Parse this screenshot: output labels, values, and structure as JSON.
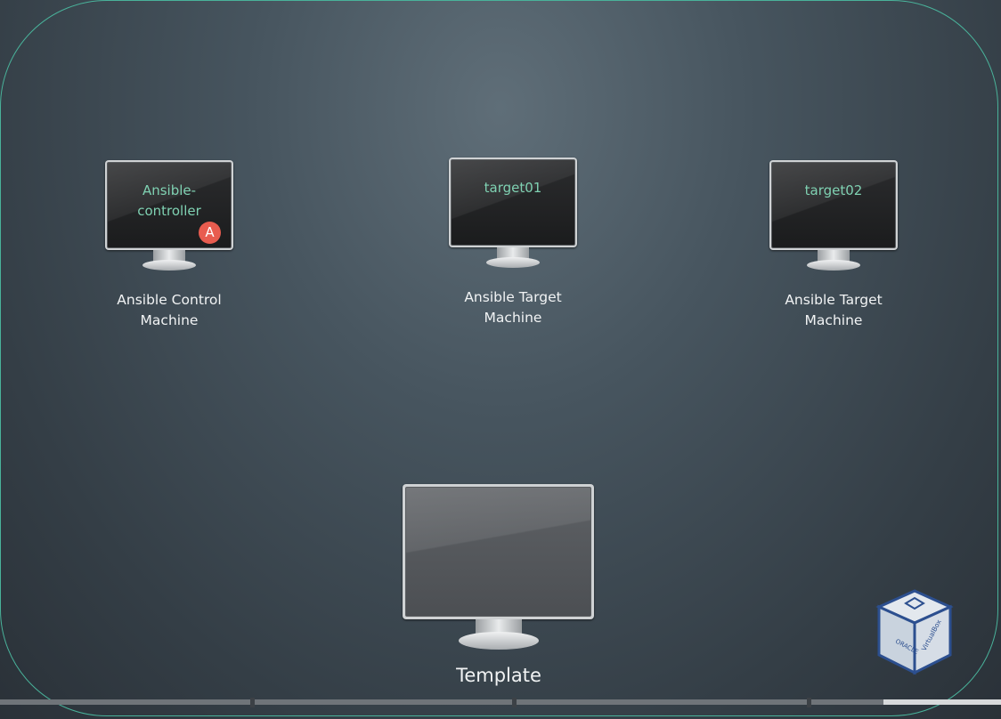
{
  "nodes": {
    "controller": {
      "screen_text": "Ansible-\ncontroller",
      "caption": "Ansible Control\nMachine",
      "badge": "A"
    },
    "target01": {
      "screen_text": "target01",
      "caption": "Ansible Target\nMachine"
    },
    "target02": {
      "screen_text": "target02",
      "caption": "Ansible Target\nMachine"
    },
    "template": {
      "caption": "Template"
    }
  },
  "logo": {
    "left_text": "ORACLE",
    "right_text": "VirtualBox",
    "icon": "virtualbox-cube-icon"
  },
  "colors": {
    "frame": "#49b29a",
    "screen_text": "#7fd1b2",
    "badge": "#e85c4f"
  }
}
